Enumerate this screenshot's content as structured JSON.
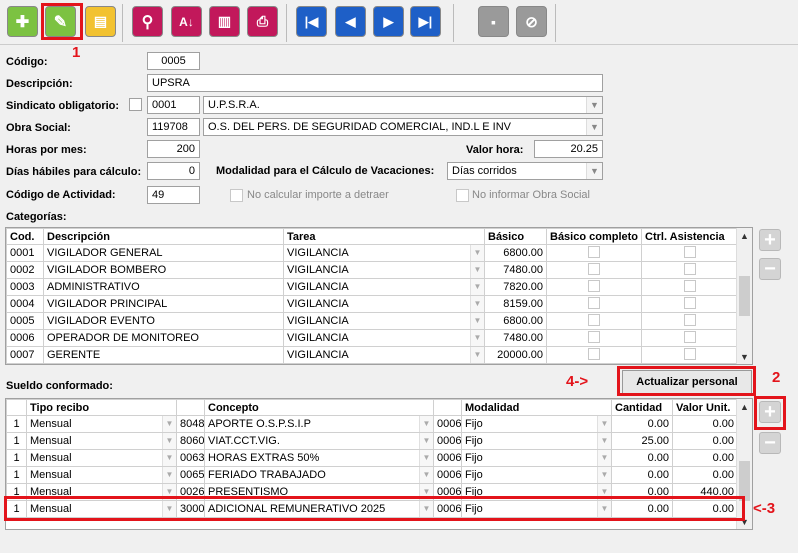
{
  "toolbar": {
    "add_icon": "plus-icon",
    "edit_icon": "pencil-icon",
    "copy_icon": "document-icon",
    "search_icon": "magnifier-icon",
    "sort_icon": "sort-az-icon",
    "report_icon": "clipboard-icon",
    "print_icon": "printer-icon",
    "first_icon": "first-icon",
    "prev_icon": "prev-icon",
    "next_icon": "next-icon",
    "last_icon": "last-icon",
    "save_icon": "save-icon",
    "cancel_icon": "cancel-icon"
  },
  "form": {
    "codigo_label": "Código:",
    "codigo": "0005",
    "descripcion_label": "Descripción:",
    "descripcion": "UPSRA",
    "sindicato_label": "Sindicato obligatorio:",
    "sindicato_code": "0001",
    "sindicato_name": "U.P.S.R.A.",
    "obra_label": "Obra Social:",
    "obra_code": "119708",
    "obra_name": "O.S. DEL PERS. DE SEGURIDAD COMERCIAL, IND.L E INV",
    "horas_label": "Horas por mes:",
    "horas": "200",
    "valor_hora_label": "Valor hora:",
    "valor_hora": "20.25",
    "dias_label": "Días hábiles para cálculo:",
    "dias": "0",
    "modalidad_label": "Modalidad para el Cálculo de Vacaciones:",
    "modalidad": "Días corridos",
    "actividad_label": "Código de Actividad:",
    "actividad": "49",
    "no_calc_label": "No calcular importe a detraer",
    "no_informar_label": "No informar Obra Social"
  },
  "categorias": {
    "title": "Categorías:",
    "headers": [
      "Cod.",
      "Descripción",
      "Tarea",
      "Básico",
      "Básico completo",
      "Ctrl. Asistencia"
    ],
    "rows": [
      [
        "0001",
        "VIGILADOR GENERAL",
        "VIGILANCIA",
        "6800.00"
      ],
      [
        "0002",
        "VIGILADOR BOMBERO",
        "VIGILANCIA",
        "7480.00"
      ],
      [
        "0003",
        "ADMINISTRATIVO",
        "VIGILANCIA",
        "7820.00"
      ],
      [
        "0004",
        "VIGILADOR PRINCIPAL",
        "VIGILANCIA",
        "8159.00"
      ],
      [
        "0005",
        "VIGILADOR EVENTO",
        "VIGILANCIA",
        "6800.00"
      ],
      [
        "0006",
        "OPERADOR DE MONITOREO",
        "VIGILANCIA",
        "7480.00"
      ],
      [
        "0007",
        "GERENTE",
        "VIGILANCIA",
        "20000.00"
      ]
    ]
  },
  "sueldo": {
    "title": "Sueldo conformado:",
    "actualizar": "Actualizar personal",
    "headers": [
      "Tipo recibo",
      "Concepto",
      "Modalidad",
      "Cantidad",
      "Valor Unit."
    ],
    "rows": [
      [
        "1",
        "Mensual",
        "8048",
        "APORTE O.S.P.S.I.P",
        "0006",
        "Fijo",
        "0.00",
        "0.00"
      ],
      [
        "1",
        "Mensual",
        "8060",
        "VIAT.CCT.VIG.",
        "0006",
        "Fijo",
        "25.00",
        "0.00"
      ],
      [
        "1",
        "Mensual",
        "0063",
        "HORAS EXTRAS 50%",
        "0006",
        "Fijo",
        "0.00",
        "0.00"
      ],
      [
        "1",
        "Mensual",
        "0065",
        "FERIADO TRABAJADO",
        "0006",
        "Fijo",
        "0.00",
        "0.00"
      ],
      [
        "1",
        "Mensual",
        "0026",
        "PRESENTISMO",
        "0006",
        "Fijo",
        "0.00",
        "440.00"
      ],
      [
        "1",
        "Mensual",
        "3000",
        "ADICIONAL REMUNERATIVO 2025",
        "0006",
        "Fijo",
        "0.00",
        "0.00"
      ]
    ]
  },
  "annotations": {
    "a1": "1",
    "a2": "2",
    "a3": "<-3",
    "a4": "4->"
  }
}
